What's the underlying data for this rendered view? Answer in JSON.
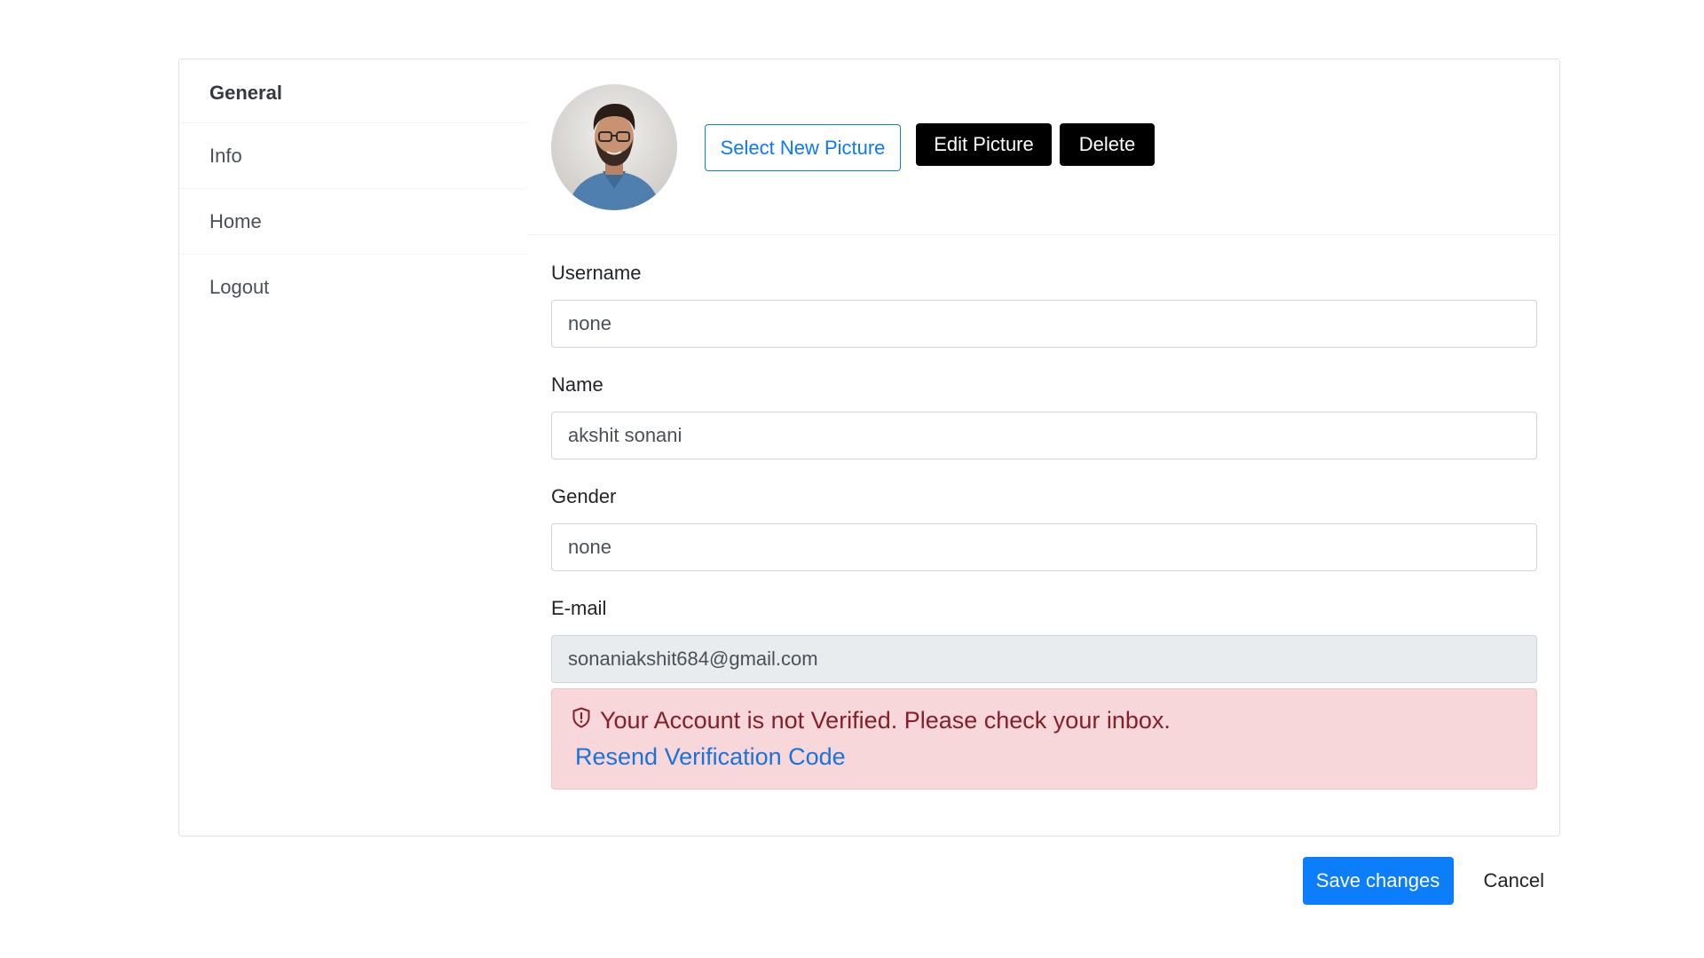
{
  "sidebar": {
    "items": [
      {
        "label": "General",
        "active": true
      },
      {
        "label": "Info"
      },
      {
        "label": "Home"
      },
      {
        "label": "Logout"
      }
    ]
  },
  "profile": {
    "avatar_icon": "user-avatar-photo",
    "select_picture_label": "Select New Picture",
    "edit_picture_label": "Edit Picture",
    "delete_label": "Delete"
  },
  "form": {
    "username": {
      "label": "Username",
      "value": "none"
    },
    "name": {
      "label": "Name",
      "value": "akshit sonani"
    },
    "gender": {
      "label": "Gender",
      "value": "none"
    },
    "email": {
      "label": "E-mail",
      "value": "sonaniakshit684@gmail.com"
    }
  },
  "alert": {
    "icon": "shield-alert-icon",
    "message": "Your Account is not Verified. Please check your inbox.",
    "link_label": "Resend Verification Code"
  },
  "actions": {
    "save_label": "Save changes",
    "cancel_label": "Cancel"
  },
  "colors": {
    "primary": "#0d7efb",
    "alert_bg": "#f8d7da",
    "alert_text": "#842029",
    "link": "#1a73d9"
  }
}
